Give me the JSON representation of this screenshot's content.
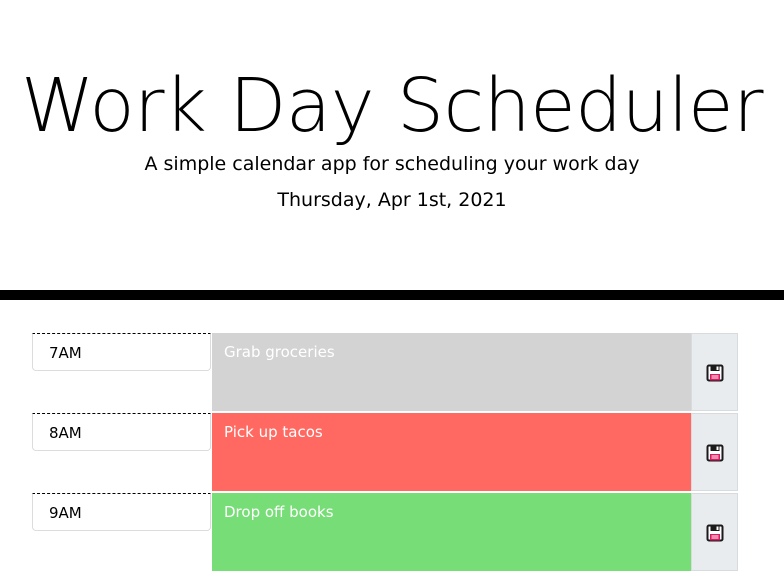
{
  "header": {
    "title": "Work Day Scheduler",
    "subtitle": "A simple calendar app for scheduling your work day",
    "current_day": "Thursday, Apr 1st, 2021"
  },
  "colors": {
    "past": "#d3d3d3",
    "present": "#ff6961",
    "future": "#77dd77",
    "divider": "#000000"
  },
  "timeblocks": [
    {
      "hour": "7AM",
      "description": "Grab groceries",
      "status": "past",
      "save_icon": "floppy-disk-icon"
    },
    {
      "hour": "8AM",
      "description": "Pick up tacos",
      "status": "present",
      "save_icon": "floppy-disk-icon"
    },
    {
      "hour": "9AM",
      "description": "Drop off books",
      "status": "future",
      "save_icon": "floppy-disk-icon"
    }
  ]
}
